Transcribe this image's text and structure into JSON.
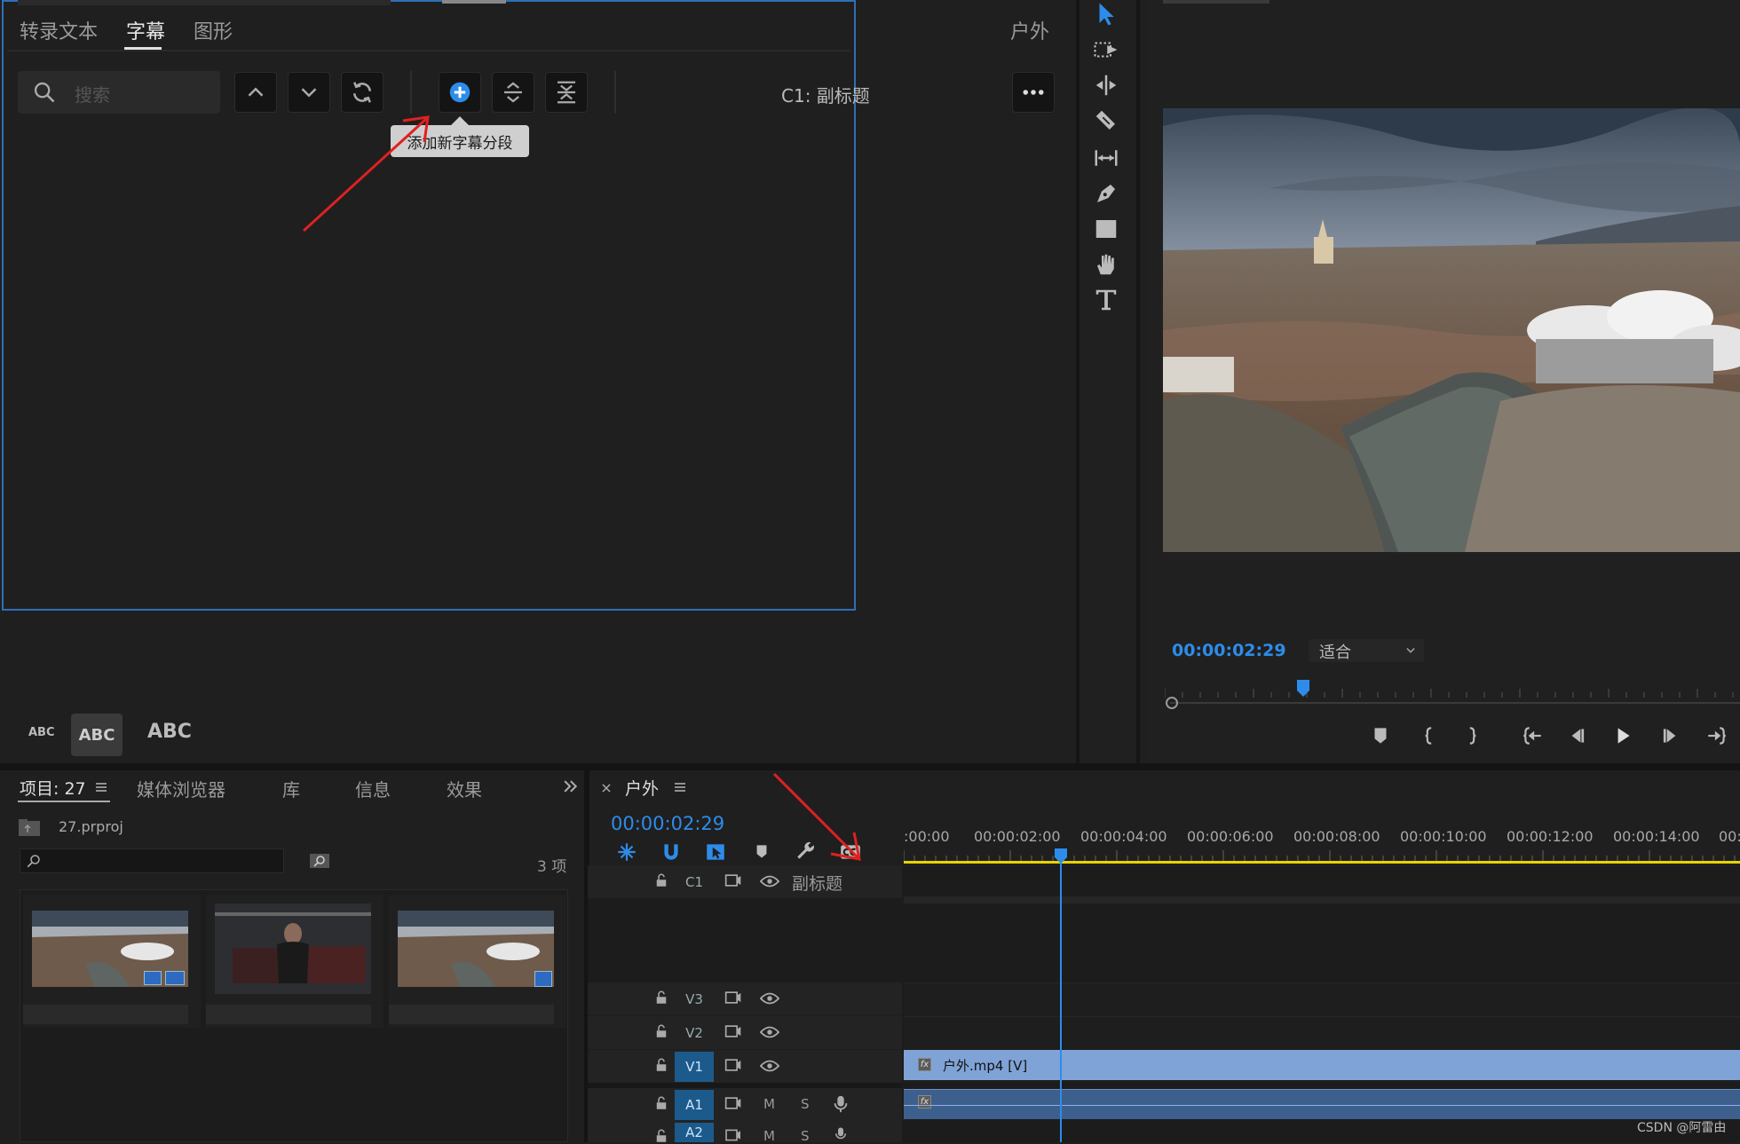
{
  "caption_panel": {
    "tabs": [
      "转录文本",
      "字幕",
      "图形"
    ],
    "active_tab": "字幕",
    "sequence_name": "户外",
    "search_placeholder": "搜索",
    "track_label": "C1: 副标题",
    "tooltip": "添加新字幕分段",
    "text_size_labels": [
      "ABC",
      "ABC",
      "ABC"
    ]
  },
  "program_monitor": {
    "timecode": "00:00:02:29",
    "zoom": "适合",
    "playhead_fraction": 0.24
  },
  "project_panel": {
    "tabs": [
      "项目: 27",
      "媒体浏览器",
      "库",
      "信息",
      "效果"
    ],
    "project_file": "27.prproj",
    "item_count": "3 项",
    "clips": [
      "city-aerial-thumbnail-1",
      "gym-thumbnail",
      "city-aerial-thumbnail-2"
    ]
  },
  "timeline": {
    "sequence_name": "户外",
    "timecode": "00:00:02:29",
    "ruler_labels": [
      ":00:00",
      "00:00:02:00",
      "00:00:04:00",
      "00:00:06:00",
      "00:00:08:00",
      "00:00:10:00",
      "00:00:12:00",
      "00:00:14:00",
      "00:"
    ],
    "caption_track": {
      "name": "C1",
      "label": "副标题"
    },
    "video_tracks": [
      "V3",
      "V2",
      "V1"
    ],
    "audio_tracks": [
      "A1",
      "A2"
    ],
    "clip_label": "户外.mp4 [V]",
    "fx_label": "fx",
    "mute_label": "M",
    "solo_label": "S"
  },
  "watermark": "CSDN @阿雷由",
  "colors": {
    "accent": "#2d8ceb",
    "clip_video": "#7fa3d6",
    "clip_audio": "#3d5f8e",
    "annotation": "#e02020"
  }
}
